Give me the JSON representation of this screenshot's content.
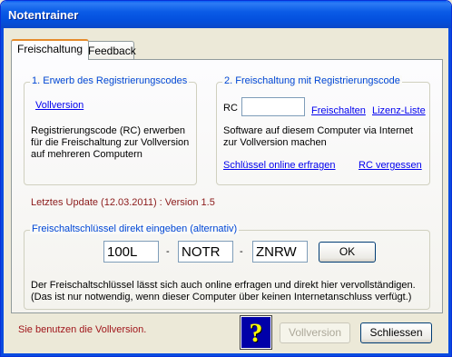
{
  "window": {
    "title": "Notentrainer"
  },
  "tabs": [
    {
      "label": "Freischaltung",
      "active": true
    },
    {
      "label": "Feedback",
      "active": false
    }
  ],
  "group1": {
    "legend": "1. Erwerb des Registrierungscodes",
    "link": "Vollversion",
    "description": "Registrierungscode (RC) erwerben für die Freischaltung zur Vollversion auf mehreren Computern"
  },
  "group2": {
    "legend": "2. Freischaltung mit Registrierungscode",
    "rc_label": "RC",
    "rc_value": "",
    "freischalten_link": "Freischalten",
    "lizenz_link": "Lizenz-Liste",
    "description": "Software auf diesem Computer via Internet zur Vollversion machen",
    "online_link": "Schlüssel online erfragen",
    "rc_forgot_link": "RC vergessen"
  },
  "update_text": "Letztes Update (12.03.2011) : Version 1.5",
  "group3": {
    "legend": "Freischaltschlüssel direkt eingeben (alternativ)",
    "key_parts": [
      "100L",
      "NOTR",
      "ZNRW"
    ],
    "separator": "-",
    "ok_label": "OK",
    "note_line1": "Der Freischaltschlüssel lässt sich auch online erfragen und direkt hier vervollständigen.",
    "note_line2": "(Das ist nur notwendig, wenn dieser Computer über keinen Internetanschluss verfügt.)"
  },
  "footer": {
    "status": "Sie benutzen die Vollversion.",
    "vollversion_button": "Vollversion",
    "close_button": "Schliessen",
    "help_glyph": "?"
  },
  "colors": {
    "titlebar": "#0a5be6",
    "legend_text": "#0046d5",
    "status_text": "#a0161b",
    "help_bg": "#0000a8",
    "help_fg": "#ffff00"
  }
}
